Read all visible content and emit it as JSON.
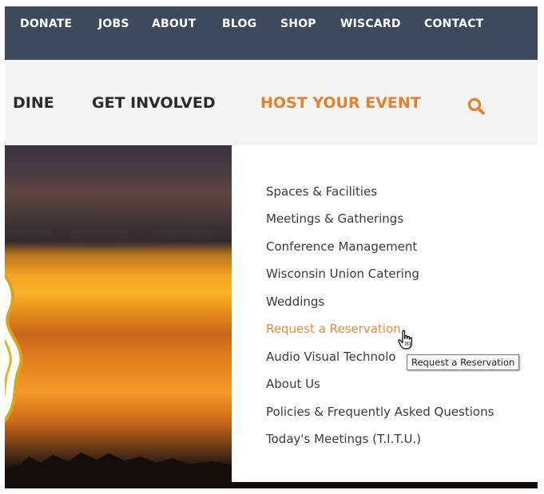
{
  "utility_nav": {
    "items": [
      "DONATE",
      "JOBS",
      "ABOUT",
      "BLOG",
      "SHOP",
      "WISCARD",
      "CONTACT"
    ]
  },
  "main_nav": {
    "items": [
      "DINE",
      "GET INVOLVED",
      "HOST YOUR EVENT"
    ],
    "active": "HOST YOUR EVENT",
    "search_icon": "search-icon"
  },
  "dropdown": {
    "items": [
      "Spaces & Facilities",
      "Meetings & Gatherings",
      "Conference Management",
      "Wisconsin Union Catering",
      "Weddings",
      "Request a Reservation",
      "Audio Visual Technolo",
      "About Us",
      "Policies & Frequently Asked Questions",
      "Today's Meetings (T.I.T.U.)"
    ],
    "hovered": "Request a Reservation"
  },
  "tooltip": {
    "text": "Request a Reservation"
  },
  "colors": {
    "utility_bar": "#3d4a5c",
    "accent": "#e87f2c",
    "nav_text": "#2b2b2b",
    "menu_text": "#3b3b3b"
  }
}
